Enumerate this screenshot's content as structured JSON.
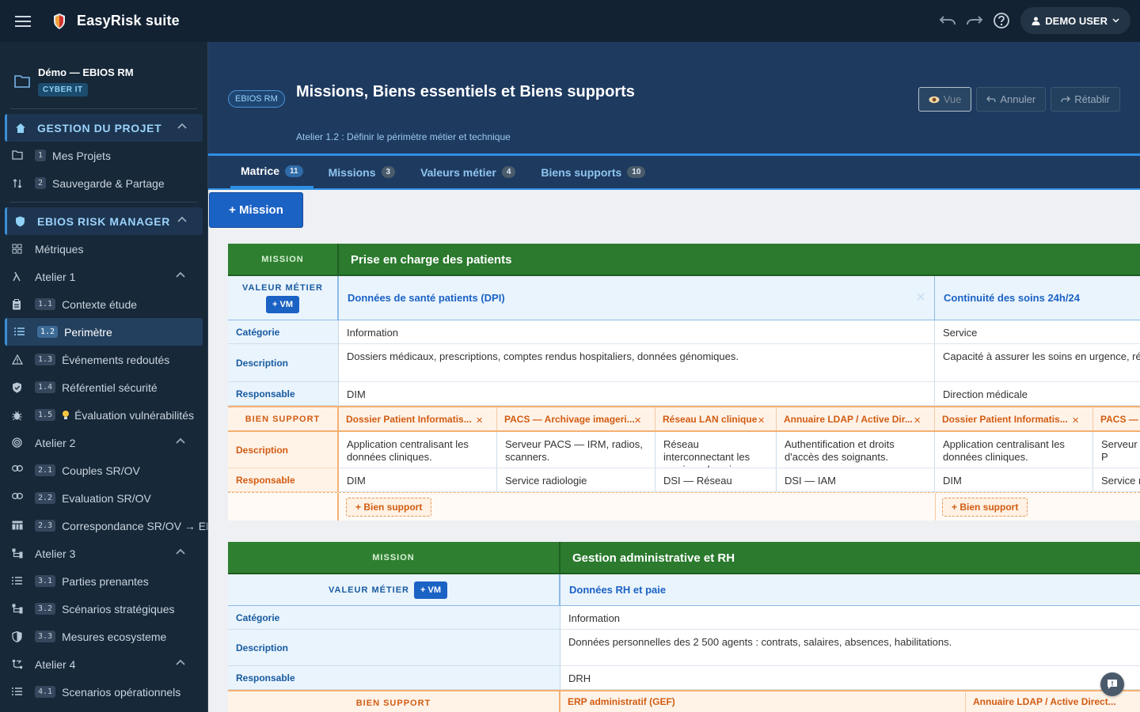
{
  "app": {
    "name": "EasyRisk suite",
    "user": "DEMO USER"
  },
  "project": {
    "name": "Démo — EBIOS RM",
    "badge": "CYBER IT"
  },
  "sidebar": {
    "section1": "GESTION DU PROJET",
    "s1_items": [
      {
        "num": "1",
        "label": "Mes Projets"
      },
      {
        "num": "2",
        "label": "Sauvegarde & Partage"
      }
    ],
    "section2": "EBIOS RISK MANAGER",
    "metrics": "Métriques",
    "atelier1": "Atelier 1",
    "a1": [
      {
        "num": "1.1",
        "label": "Contexte étude"
      },
      {
        "num": "1.2",
        "label": "Perimètre"
      },
      {
        "num": "1.3",
        "label": "Événements redoutés"
      },
      {
        "num": "1.4",
        "label": "Référentiel sécurité"
      },
      {
        "num": "1.5",
        "label": "Évaluation vulnérabilités"
      }
    ],
    "atelier2": "Atelier 2",
    "a2": [
      {
        "num": "2.1",
        "label": "Couples SR/OV"
      },
      {
        "num": "2.2",
        "label": "Evaluation SR/OV"
      },
      {
        "num": "2.3",
        "label": "Correspondance SR/OV → ER"
      }
    ],
    "atelier3": "Atelier 3",
    "a3": [
      {
        "num": "3.1",
        "label": "Parties prenantes"
      },
      {
        "num": "3.2",
        "label": "Scénarios stratégiques"
      },
      {
        "num": "3.3",
        "label": "Mesures ecosysteme"
      }
    ],
    "atelier4": "Atelier 4",
    "a4": [
      {
        "num": "4.1",
        "label": "Scenarios opérationnels"
      }
    ]
  },
  "header": {
    "badge": "EBIOS RM",
    "title": "Missions, Biens essentiels et Biens supports",
    "subtitle": "Atelier 1.2 : Définir le périmètre métier et technique",
    "btn_vue": "Vue",
    "btn_annuler": "Annuler",
    "btn_retablir": "Rétablir"
  },
  "tabs": [
    {
      "label": "Matrice",
      "count": "11"
    },
    {
      "label": "Missions",
      "count": "3"
    },
    {
      "label": "Valeurs métier",
      "count": "4"
    },
    {
      "label": "Biens supports",
      "count": "10"
    }
  ],
  "add_mission": "+ Mission",
  "labels": {
    "mission": "MISSION",
    "valeur_metier": "VALEUR MÉTIER",
    "add_vm": "+ VM",
    "categorie": "Catégorie",
    "description": "Description",
    "responsable": "Responsable",
    "bien_support": "BIEN SUPPORT",
    "add_bs": "+ Bien support"
  },
  "missions": [
    {
      "title": "Prise en charge des patients",
      "vms": [
        {
          "name": "Données de santé patients (DPI)",
          "categorie": "Information",
          "description": "Dossiers médicaux, prescriptions, comptes rendus hospitaliers, données génomiques.",
          "responsable": "DIM"
        },
        {
          "name": "Continuité des soins 24h/24",
          "categorie": "Service",
          "description": "Capacité à assurer les soins en urgence, réa",
          "responsable": "Direction médicale"
        }
      ],
      "bs": [
        {
          "name": "Dossier Patient Informatis...",
          "description": "Application centralisant les données cliniques.",
          "responsable": "DIM"
        },
        {
          "name": "PACS — Archivage imageri...",
          "description": "Serveur PACS — IRM, radios, scanners.",
          "responsable": "Service radiologie"
        },
        {
          "name": "Réseau LAN clinique",
          "description": "Réseau interconnectant les services de soins.",
          "responsable": "DSI — Réseau"
        },
        {
          "name": "Annuaire LDAP / Active Dir...",
          "description": "Authentification et droits d'accès des soignants.",
          "responsable": "DSI — IAM"
        },
        {
          "name": "Dossier Patient Informatis...",
          "description": "Application centralisant les données cliniques.",
          "responsable": "DIM"
        },
        {
          "name": "PACS — A",
          "description": "Serveur P scanners",
          "responsable": "Service r"
        }
      ]
    },
    {
      "title": "Gestion administrative et RH",
      "vms": [
        {
          "name": "Données RH et paie",
          "categorie": "Information",
          "description": "Données personnelles des 2 500 agents : contrats, salaires, absences, habilitations.",
          "responsable": "DRH"
        }
      ],
      "bs": [
        {
          "name": "ERP administratif (GEF)"
        },
        {
          "name": "Annuaire LDAP / Active Direct..."
        }
      ]
    }
  ],
  "colors": {
    "topbar": "#132233",
    "sidebar": "#172838",
    "accent": "#2e8fe3",
    "mission": "#2b7a2e",
    "bien_support": "#d15c12"
  }
}
